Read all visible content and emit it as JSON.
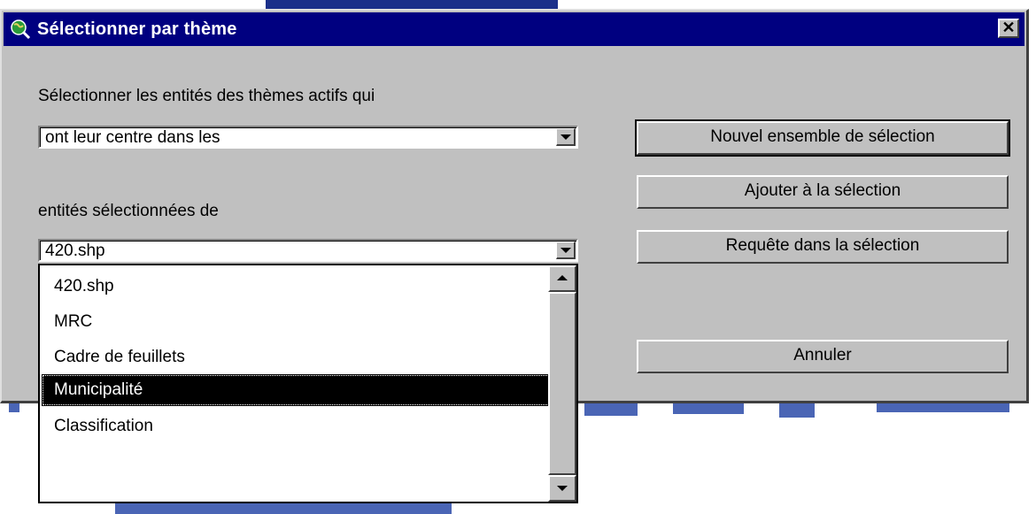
{
  "window": {
    "title": "Sélectionner par thème",
    "close_symbol": "✕"
  },
  "labels": {
    "select_features": "Sélectionner les entités des thèmes actifs qui",
    "selected_features_of": "entités sélectionnées de"
  },
  "method_combo": {
    "value": "ont leur centre dans les"
  },
  "theme_combo": {
    "value": "420.shp",
    "options": [
      "420.shp",
      "MRC",
      "Cadre de feuillets",
      "Municipalité",
      "Classification"
    ],
    "highlighted": "Municipalité"
  },
  "buttons": {
    "new_set": "Nouvel ensemble de sélection",
    "add_to": "Ajouter à la sélection",
    "select_from": "Requête dans la sélection",
    "cancel": "Annuler"
  },
  "icons": {
    "window_icon": "globe-magnifier-icon",
    "close": "close-icon",
    "dropdown_arrow": "chevron-down-icon",
    "scroll_up": "scroll-up-arrow-icon",
    "scroll_down": "scroll-down-arrow-icon"
  },
  "colors": {
    "titlebar": "#000080",
    "face": "#c0c0c0",
    "selection": "#000000"
  }
}
